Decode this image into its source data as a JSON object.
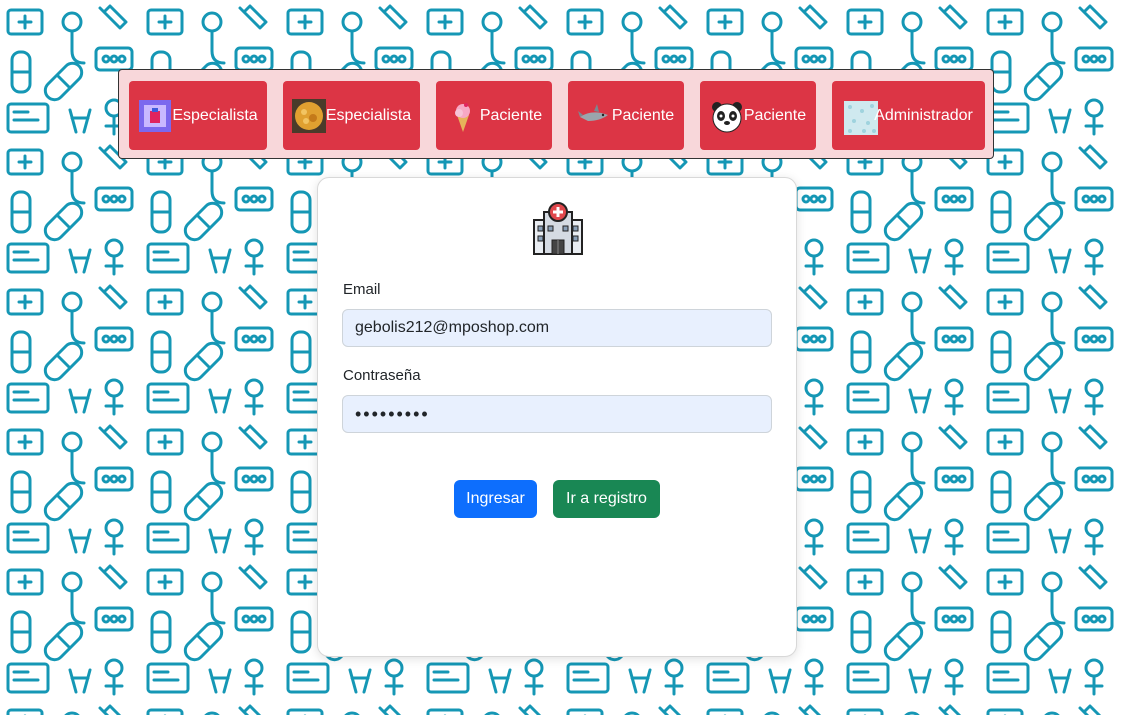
{
  "quick_access": [
    {
      "label": "Especialista",
      "avatar": "purple-frame-image"
    },
    {
      "label": "Especialista",
      "avatar": "food-dish-image"
    },
    {
      "label": "Paciente",
      "avatar": "ice-cream-image"
    },
    {
      "label": "Paciente",
      "avatar": "shark-image"
    },
    {
      "label": "Paciente",
      "avatar": "panda-image"
    },
    {
      "label": "Administrador",
      "avatar": "texture-image"
    }
  ],
  "login": {
    "logo": "hospital-icon",
    "email_label": "Email",
    "email_value": "gebolis212@mposhop.com",
    "password_label": "Contraseña",
    "password_value": "•••••••••",
    "submit_label": "Ingresar",
    "register_label": "Ir a registro"
  },
  "colors": {
    "quick_bar_bg": "#f8d7da",
    "quick_button": "#dc3545",
    "primary": "#0d6efd",
    "success": "#198754",
    "pattern": "#1597b5",
    "input_bg": "#e8f0fe"
  }
}
